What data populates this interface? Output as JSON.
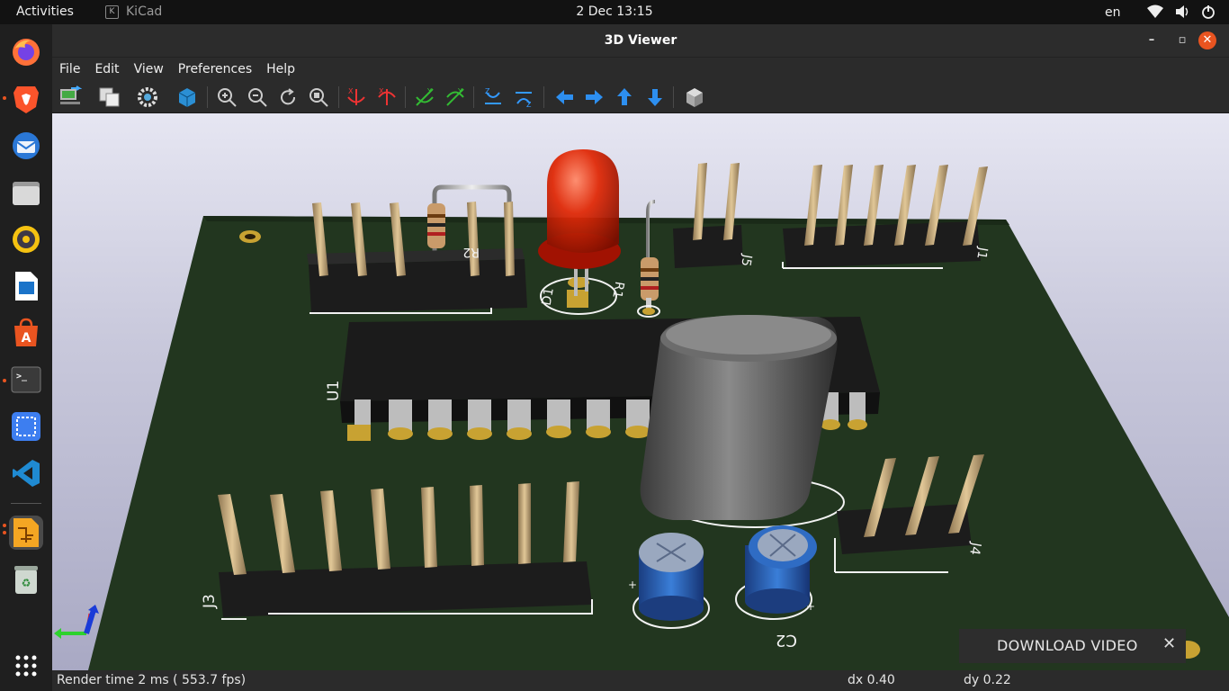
{
  "topbar": {
    "activities": "Activities",
    "app_name": "KiCad",
    "clock": "2 Dec  13:15",
    "lang": "en",
    "tray_icons": [
      "wifi-icon",
      "volume-icon",
      "power-icon"
    ]
  },
  "dock": {
    "items": [
      {
        "name": "firefox-icon",
        "color": "#ff7139"
      },
      {
        "name": "brave-icon",
        "color": "#fb542b"
      },
      {
        "name": "thunderbird-icon",
        "color": "#2a77d6"
      },
      {
        "name": "files-icon",
        "color": "#9a9a9a"
      },
      {
        "name": "rhythmbox-icon",
        "color": "#f5c211"
      },
      {
        "name": "writer-icon",
        "color": "#1a73c9"
      },
      {
        "name": "software-icon",
        "color": "#e95420"
      },
      {
        "name": "terminal-icon",
        "color": "#3a3a3a"
      },
      {
        "name": "screenshot-icon",
        "color": "#3d7ef0"
      },
      {
        "name": "vscode-icon",
        "color": "#1f8ad2"
      },
      {
        "name": "kicad-icon",
        "color": "#f4a623"
      },
      {
        "name": "trash-icon",
        "color": "#cfd8d0"
      },
      {
        "name": "app-grid-icon",
        "color": "#1f1f1f"
      }
    ]
  },
  "window": {
    "title": "3D Viewer",
    "menu": [
      "File",
      "Edit",
      "View",
      "Preferences",
      "Help"
    ]
  },
  "toolbar": {
    "tools": [
      "reload-board-icon",
      "copy-image-icon",
      "render-settings-icon",
      "raytrace-icon",
      "zoom-in-icon",
      "zoom-out-icon",
      "redraw-icon",
      "zoom-fit-icon",
      "rotate-x-cw-icon",
      "rotate-x-ccw-icon",
      "rotate-y-cw-icon",
      "rotate-y-ccw-icon",
      "rotate-z-cw-icon",
      "rotate-z-ccw-icon",
      "pan-left-icon",
      "pan-right-icon",
      "pan-up-icon",
      "pan-down-icon",
      "view-cube-icon"
    ]
  },
  "board": {
    "silkscreen": {
      "u1": "U1",
      "r2": "R2",
      "r1": "R1",
      "j5": "J5",
      "j1": "J1",
      "j3": "J3",
      "j4": "J4",
      "c2": "C2",
      "led": "D1"
    },
    "colors": {
      "pcb": "#22361f",
      "silk": "#f2f2f2",
      "pin": "#c9ad7c",
      "pad": "#c8a232"
    }
  },
  "popup": {
    "label": "DOWNLOAD VIDEO",
    "close": "✕"
  },
  "status": {
    "render": "Render time 2 ms ( 553.7 fps)",
    "dx": "dx 0.40",
    "dy": "dy 0.22"
  }
}
